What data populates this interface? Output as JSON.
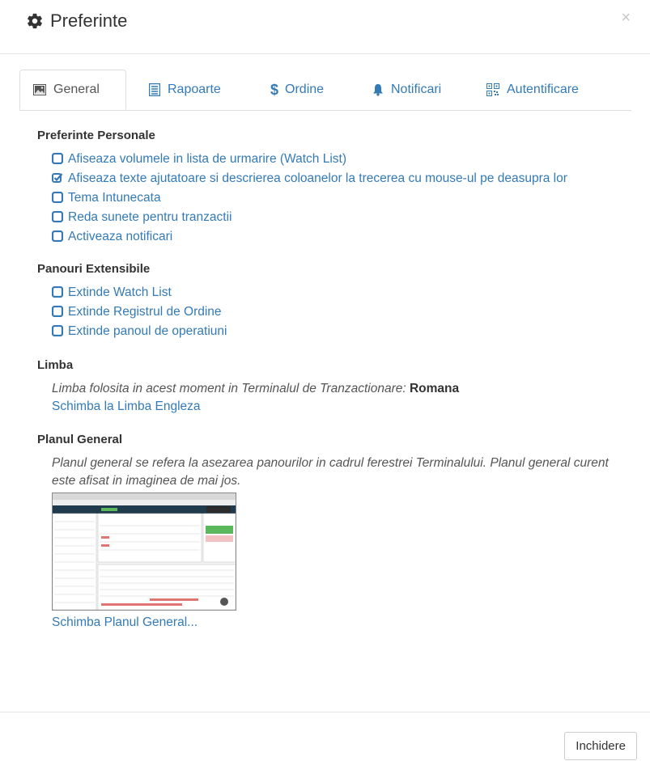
{
  "header": {
    "title": "Preferinte",
    "close_symbol": "×"
  },
  "tabs": [
    {
      "label": "General",
      "icon": "image-icon",
      "active": true
    },
    {
      "label": "Rapoarte",
      "icon": "report-icon"
    },
    {
      "label": "Ordine",
      "icon": "dollar-icon"
    },
    {
      "label": "Notificari",
      "icon": "bell-icon"
    },
    {
      "label": "Autentificare",
      "icon": "qrcode-icon"
    }
  ],
  "sections": {
    "personal": {
      "title": "Preferinte Personale",
      "options": [
        {
          "label": "Afiseaza volumele in lista de urmarire (Watch List)",
          "checked": false
        },
        {
          "label": "Afiseaza texte ajutatoare si descrierea coloanelor la trecerea cu mouse-ul pe deasupra lor",
          "checked": true
        },
        {
          "label": "Tema Intunecata",
          "checked": false
        },
        {
          "label": "Reda sunete pentru tranzactii",
          "checked": false
        },
        {
          "label": "Activeaza notificari",
          "checked": false
        }
      ]
    },
    "panels": {
      "title": "Panouri Extensibile",
      "options": [
        {
          "label": "Extinde Watch List",
          "checked": false
        },
        {
          "label": "Extinde Registrul de Ordine",
          "checked": false
        },
        {
          "label": "Extinde panoul de operatiuni",
          "checked": false
        }
      ]
    },
    "language": {
      "title": "Limba",
      "text": "Limba folosita in acest moment in Terminalul de Tranzactionare:",
      "current": "Romana",
      "link": "Schimba la Limba Engleza"
    },
    "layout": {
      "title": "Planul General",
      "text": "Planul general se refera la asezarea panourilor in cadrul ferestrei Terminalului. Planul general curent este afisat in imaginea de mai jos.",
      "link": "Schimba Planul General..."
    }
  },
  "footer": {
    "close_label": "Inchidere"
  },
  "colors": {
    "link": "#337ab7",
    "text": "#333333",
    "border": "#dddddd"
  }
}
